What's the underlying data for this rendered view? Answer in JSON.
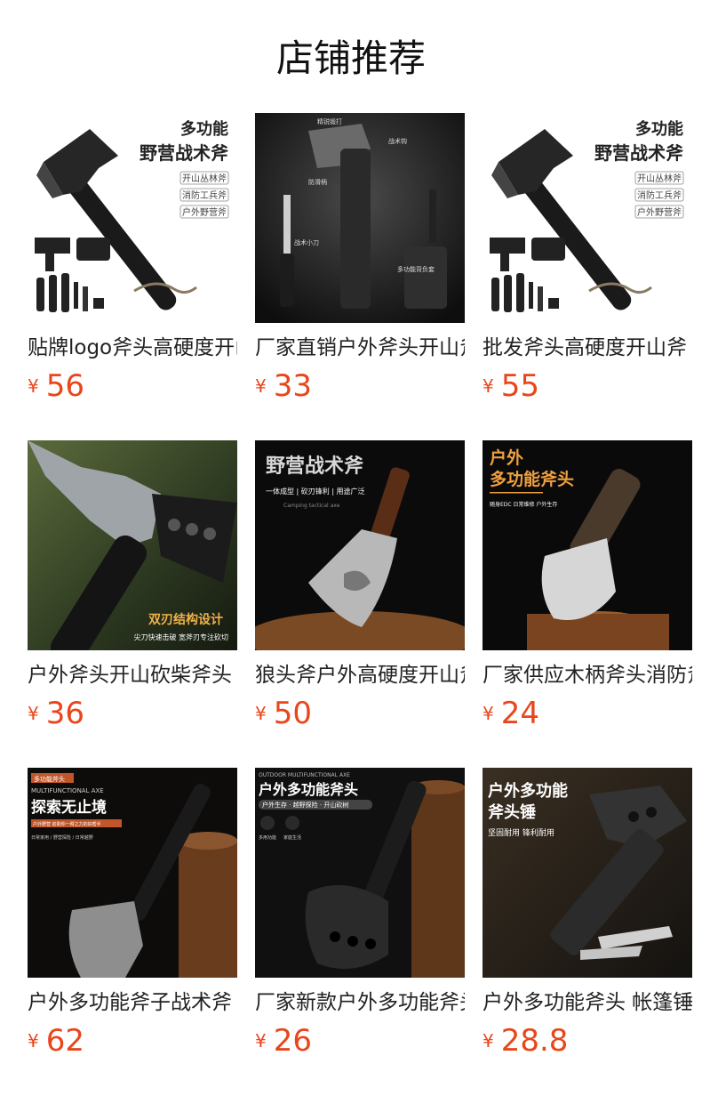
{
  "section": {
    "title": "店铺推荐"
  },
  "products": [
    {
      "title": "贴牌logo斧头高硬度开山砍柴斧",
      "currency": "¥",
      "price": "56",
      "image": {
        "theme": "light",
        "banner": "多功能",
        "banner2": "野营战术斧",
        "tags": [
          "开山丛林斧",
          "消防工兵斧",
          "户外野营斧"
        ]
      }
    },
    {
      "title": "厂家直销户外斧头开山斧",
      "currency": "¥",
      "price": "33",
      "image": {
        "theme": "dark-studio",
        "callouts": [
          "精锐锻打",
          "战术钩",
          "防滑柄",
          "战术小刀",
          "多功能背负套"
        ]
      }
    },
    {
      "title": "批发斧头高硬度开山斧",
      "currency": "¥",
      "price": "55",
      "image": {
        "theme": "light",
        "banner": "多功能",
        "banner2": "野营战术斧",
        "tags": [
          "开山丛林斧",
          "消防工兵斧",
          "户外野营斧"
        ]
      }
    },
    {
      "title": "户外斧头开山砍柴斧头",
      "currency": "¥",
      "price": "36",
      "image": {
        "theme": "forest",
        "banner": "双刃结构设计",
        "banner2": "尖刀快速击破  宽斧刃专注砍切"
      }
    },
    {
      "title": "狼头斧户外高硬度开山斧",
      "currency": "¥",
      "price": "50",
      "image": {
        "theme": "dark-wood",
        "banner": "野营战术斧",
        "banner2": "一体成型 | 砍刃锋利 | 用途广泛",
        "banner3": "Camping tactical axe"
      }
    },
    {
      "title": "厂家供应木柄斧头消防斧",
      "currency": "¥",
      "price": "24",
      "image": {
        "theme": "dark-orange",
        "banner": "户外",
        "banner2": "多功能斧头",
        "banner3": "随身EDC  日常维修  户外生存"
      }
    },
    {
      "title": "户外多功能斧子战术斧",
      "currency": "¥",
      "price": "62",
      "image": {
        "theme": "dark-log",
        "banner": "多功能斧头",
        "banner2": "MULTIFUNCTIONAL AXE",
        "banner3": "探索无止境",
        "banner4": "户外野营 前助你一臂之力的好帮手",
        "banner5": "日常家用 / 野营探险 / 日常越野"
      }
    },
    {
      "title": "厂家新款户外多功能斧头",
      "currency": "¥",
      "price": "26",
      "image": {
        "theme": "dark-log2",
        "banner": "OUTDOOR MULTIFUNCTIONAL AXE",
        "banner2": "户外多功能斧头",
        "banner3": "户外生存 · 越野探险 · 开山砍树",
        "badges": [
          "多用功能",
          "家庭生活"
        ]
      }
    },
    {
      "title": "户外多功能斧头 帐篷锤",
      "currency": "¥",
      "price": "28.8",
      "image": {
        "theme": "dark-forest",
        "banner": "户外多功能",
        "banner2": "斧头锤",
        "banner3": "坚固耐用 锋利耐用"
      }
    }
  ]
}
